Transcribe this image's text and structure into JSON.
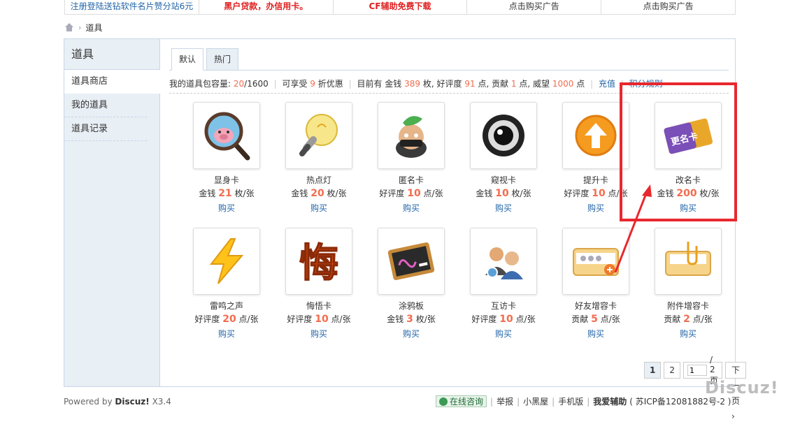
{
  "ads": [
    {
      "label": "注册登陆送钻软件名片赞分站6元",
      "style": "blue"
    },
    {
      "label": "黑户贷款，办信用卡。",
      "style": "red"
    },
    {
      "label": "CF辅助免费下载",
      "style": "red"
    },
    {
      "label": "点击购买广告",
      "style": "plain"
    },
    {
      "label": "点击购买广告",
      "style": "plain"
    }
  ],
  "breadcrumb": {
    "separator": "›",
    "current": "道具"
  },
  "sidebar": {
    "title": "道具",
    "items": [
      {
        "label": "道具商店",
        "active": true
      },
      {
        "label": "我的道具",
        "active": false
      },
      {
        "label": "道具记录",
        "active": false
      }
    ]
  },
  "tabs": [
    {
      "label": "默认",
      "active": true
    },
    {
      "label": "热门",
      "active": false
    }
  ],
  "info": {
    "capacity_label": "我的道具包容量:",
    "capacity_used": "20",
    "capacity_total": "/1600",
    "discount_pre": "可享受",
    "discount_num": "9",
    "discount_post": "折优惠",
    "own_label": "目前有 金钱",
    "money": "389",
    "money_unit": "枚, 好评度",
    "rating": "91",
    "rating_unit": "点, 贡献",
    "contrib": "1",
    "contrib_unit": "点, 威望",
    "prestige": "1000",
    "prestige_unit": "点",
    "recharge": "充值",
    "points_rule": "积分规则"
  },
  "items": [
    {
      "name": "显身卡",
      "currency": "金钱",
      "price": "21",
      "unit": "枚/张",
      "buy": "购买",
      "icon": "magnifier-pig-icon"
    },
    {
      "name": "热点灯",
      "currency": "金钱",
      "price": "20",
      "unit": "枚/张",
      "buy": "购买",
      "icon": "lightbulb-icon"
    },
    {
      "name": "匿名卡",
      "currency": "好评度",
      "price": "10",
      "unit": "点/张",
      "buy": "购买",
      "icon": "masked-head-icon"
    },
    {
      "name": "窥视卡",
      "currency": "金钱",
      "price": "10",
      "unit": "枚/张",
      "buy": "购买",
      "icon": "eye-lens-icon"
    },
    {
      "name": "提升卡",
      "currency": "好评度",
      "price": "10",
      "unit": "点/张",
      "buy": "购买",
      "icon": "up-arrow-icon"
    },
    {
      "name": "改名卡",
      "currency": "金钱",
      "price": "200",
      "unit": "枚/张",
      "buy": "购买",
      "icon": "rename-card-icon",
      "card_text": "更名卡"
    },
    {
      "name": "雷鸣之声",
      "currency": "好评度",
      "price": "20",
      "unit": "点/张",
      "buy": "购买",
      "icon": "lightning-icon"
    },
    {
      "name": "悔悟卡",
      "currency": "好评度",
      "price": "10",
      "unit": "点/张",
      "buy": "购买",
      "icon": "regret-char-icon",
      "glyph": "悔"
    },
    {
      "name": "涂鸦板",
      "currency": "金钱",
      "price": "3",
      "unit": "枚/张",
      "buy": "购买",
      "icon": "chalkboard-icon"
    },
    {
      "name": "互访卡",
      "currency": "好评度",
      "price": "10",
      "unit": "点/张",
      "buy": "购买",
      "icon": "visit-people-icon"
    },
    {
      "name": "好友增容卡",
      "currency": "贡献",
      "price": "5",
      "unit": "点/张",
      "buy": "购买",
      "icon": "friend-expand-icon"
    },
    {
      "name": "附件增容卡",
      "currency": "贡献",
      "price": "2",
      "unit": "点/张",
      "buy": "购买",
      "icon": "attachment-expand-icon"
    }
  ],
  "pager": {
    "pages": [
      "1",
      "2"
    ],
    "current": "1",
    "jump_value": "1",
    "total": "/ 2 页",
    "next": "下一页"
  },
  "footer": {
    "powered_pre": "Powered by",
    "powered_brand": "Discuz!",
    "powered_ver": "X3.4",
    "links": [
      "在线咨询",
      "举报",
      "小黑屋",
      "手机版",
      "我爱辅助"
    ],
    "icp": "( 苏ICP备12081882号-2 )",
    "watermark": "Discuz!"
  },
  "colors": {
    "accent_red": "#f26c4f",
    "link_blue": "#2366a8",
    "annotation_red": "#e8282e"
  }
}
